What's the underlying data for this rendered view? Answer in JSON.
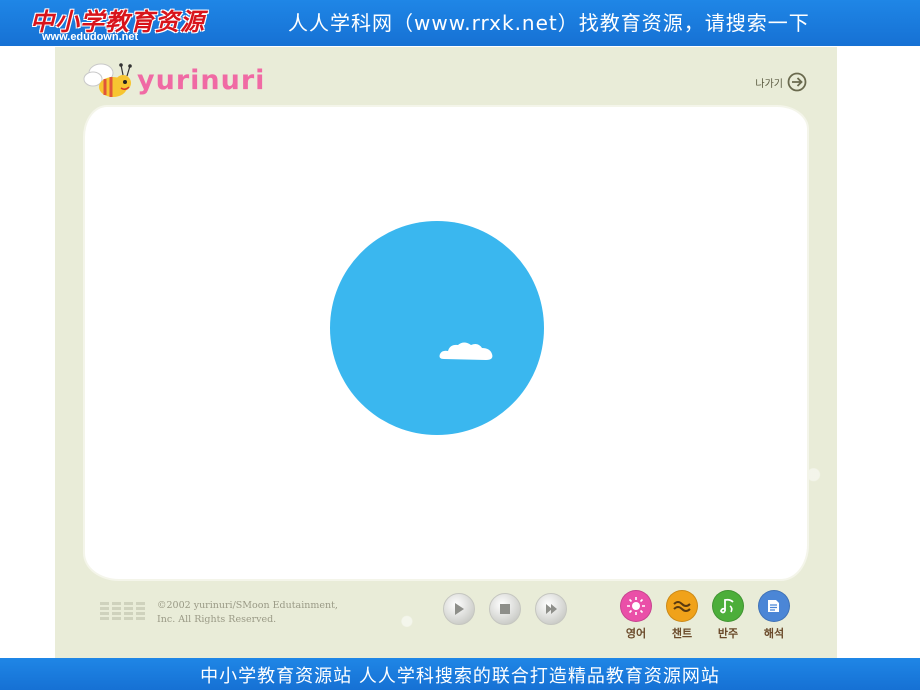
{
  "top_banner": {
    "logo_text": "中小学教育资源",
    "domain": "www.edudown.net",
    "slogan": "人人学科网（www.rrxk.net）找教育资源，请搜索一下"
  },
  "player": {
    "brand_name": "yurinuri",
    "exit_label": "나가기",
    "copyright_line1": "©2002 yurinuri/SMoon Edutainment,",
    "copyright_line2": "Inc. All Rights Reserved.",
    "modes": [
      {
        "label": "영어",
        "color": "#ea4fa8",
        "icon": "sun-icon"
      },
      {
        "label": "챈트",
        "color": "#f0a21a",
        "icon": "wave-icon"
      },
      {
        "label": "반주",
        "color": "#4cae3a",
        "icon": "note-icon"
      },
      {
        "label": "해석",
        "color": "#4b86d6",
        "icon": "book-icon"
      }
    ],
    "controls": [
      "play",
      "stop",
      "next"
    ],
    "colors": {
      "globe": "#3ab7ef",
      "frame": "#e9ecd8",
      "brand": "#f06aa4"
    }
  },
  "bottom_banner": {
    "text": "中小学教育资源站 人人学科搜索的联合打造精品教育资源网站"
  }
}
